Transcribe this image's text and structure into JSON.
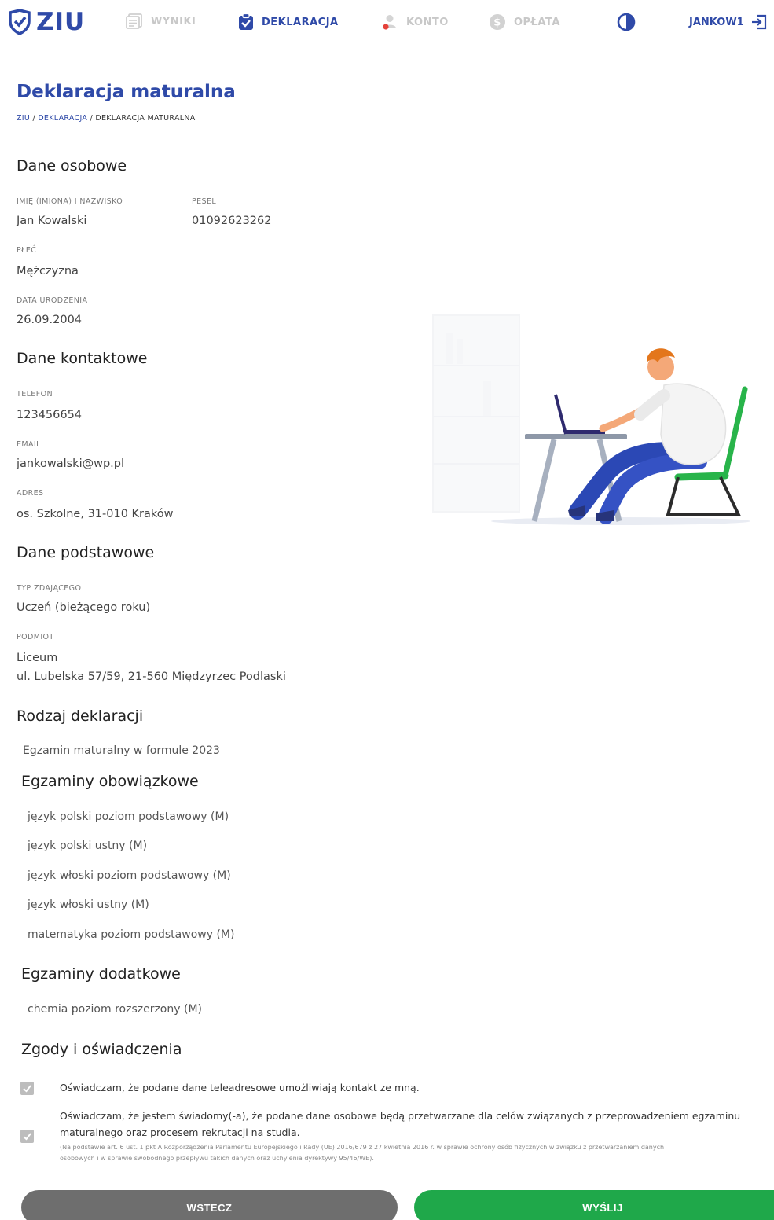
{
  "nav": {
    "logo": "ZIU",
    "items": [
      {
        "label": "WYNIKI"
      },
      {
        "label": "DEKLARACJA"
      },
      {
        "label": "KONTO"
      },
      {
        "label": "OPŁATA"
      }
    ],
    "user": "JANKOW1"
  },
  "page": {
    "title": "Deklaracja maturalna",
    "breadcrumb": [
      "ZIU",
      "DEKLARACJA",
      "DEKLARACJA MATURALNA"
    ],
    "breadcrumb_sep": " / "
  },
  "personal": {
    "title": "Dane osobowe",
    "name_label": "IMIĘ (IMIONA) I NAZWISKO",
    "name_value": "Jan Kowalski",
    "pesel_label": "PESEL",
    "pesel_value": "01092623262",
    "sex_label": "PŁEĆ",
    "sex_value": "Mężczyzna",
    "birth_label": "DATA URODZENIA",
    "birth_value": "26.09.2004"
  },
  "contact": {
    "title": "Dane kontaktowe",
    "phone_label": "TELEFON",
    "phone_value": "123456654",
    "email_label": "EMAIL",
    "email_value": "jankowalski@wp.pl",
    "address_label": "ADRES",
    "address_value": "os. Szkolne, 31-010 Kraków"
  },
  "basic": {
    "title": "Dane podstawowe",
    "type_label": "TYP ZDAJĄCEGO",
    "type_value": "Uczeń (bieżącego roku)",
    "entity_label": "PODMIOT",
    "entity_line1": "Liceum",
    "entity_line2": "ul. Lubelska 57/59, 21-560 Międzyrzec Podlaski"
  },
  "declaration": {
    "title": "Rodzaj deklaracji",
    "value": "Egzamin maturalny w formule 2023"
  },
  "mandatory": {
    "title": "Egzaminy obowiązkowe",
    "items": [
      "język polski poziom podstawowy (M)",
      "język polski ustny (M)",
      "język włoski poziom podstawowy (M)",
      "język włoski ustny (M)",
      "matematyka poziom podstawowy (M)"
    ]
  },
  "additional": {
    "title": "Egzaminy dodatkowe",
    "items": [
      "chemia poziom rozszerzony (M)"
    ]
  },
  "consents": {
    "title": "Zgody i oświadczenia",
    "c1": "Oświadczam, że podane dane teleadresowe umożliwiają kontakt ze mną.",
    "c2_line1": "Oświadczam, że jestem świadomy(-a), że podane dane osobowe będą przetwarzane dla celów związanych z przeprowadzeniem egzaminu",
    "c2_line2": "maturalnego oraz procesem rekrutacji na studia.",
    "c2_note1": "(Na podstawie art. 6 ust. 1 pkt A Rozporządzenia Parlamentu Europejskiego i Rady (UE) 2016/679 z 27 kwietnia 2016 r. w sprawie ochrony osób fizycznych w związku z przetwarzaniem danych",
    "c2_note2": "osobowych i w sprawie swobodnego przepływu takich danych oraz uchylenia dyrektywy 95/46/WE)."
  },
  "buttons": {
    "back": "WSTECZ",
    "send": "WYŚLIJ"
  },
  "colors": {
    "brand": "#2f4aa8",
    "success": "#1fa84a",
    "neutral": "#6e6e6e"
  }
}
